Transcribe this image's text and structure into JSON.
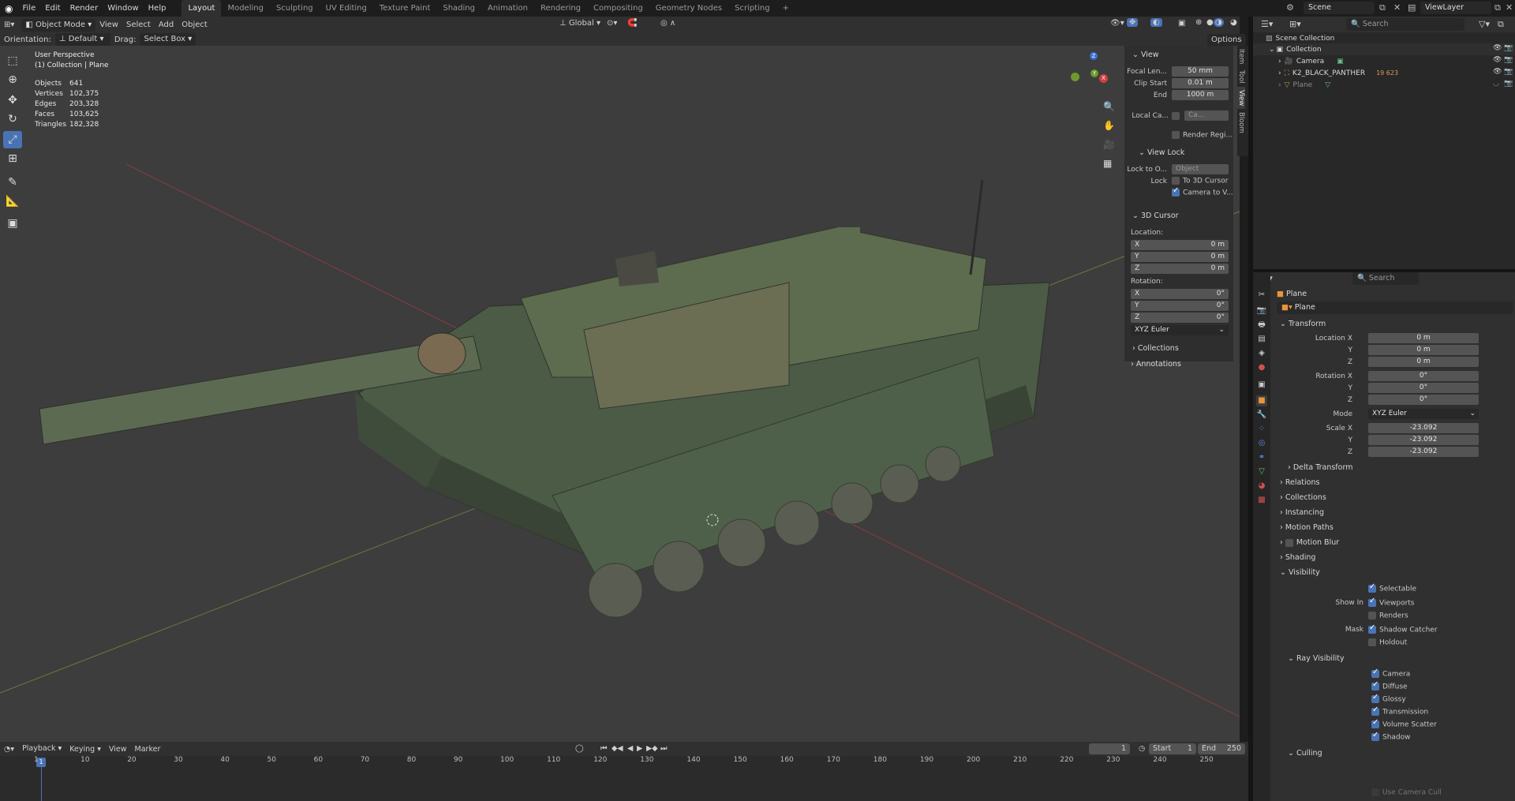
{
  "menu": {
    "logo": "blender-logo",
    "file": "File",
    "edit": "Edit",
    "render": "Render",
    "window": "Window",
    "help": "Help"
  },
  "workspaces": [
    "Layout",
    "Modeling",
    "Sculpting",
    "UV Editing",
    "Texture Paint",
    "Shading",
    "Animation",
    "Rendering",
    "Compositing",
    "Geometry Nodes",
    "Scripting",
    "+"
  ],
  "topright": {
    "scene": "Scene",
    "view_layer": "ViewLayer"
  },
  "viewport_header": {
    "mode": "Object Mode",
    "view": "View",
    "select": "Select",
    "add": "Add",
    "object": "Object",
    "transform": "Global",
    "orientation_label": "Orientation:",
    "orientation": "Default",
    "drag_label": "Drag:",
    "drag": "Select Box",
    "options": "Options"
  },
  "overlay": {
    "perspective": "User Perspective",
    "collection": "(1) Collection | Plane"
  },
  "stats": [
    {
      "k": "Objects",
      "v": "641"
    },
    {
      "k": "Vertices",
      "v": "102,375"
    },
    {
      "k": "Edges",
      "v": "203,328"
    },
    {
      "k": "Faces",
      "v": "103,625"
    },
    {
      "k": "Triangles",
      "v": "182,328"
    }
  ],
  "npanel": {
    "view_title": "View",
    "focal_label": "Focal Len...",
    "focal": "50 mm",
    "clip_start_label": "Clip Start",
    "clip_start": "0.01 m",
    "end_label": "End",
    "end": "1000 m",
    "local_cam_label": "Local Ca...",
    "local_cam": "Ca...",
    "render_region": "Render Regi...",
    "view_lock": "View Lock",
    "lock_obj_label": "Lock to O...",
    "lock_obj": "Object",
    "lock_label": "Lock",
    "to_cursor": "To 3D Cursor",
    "cam_to_view": "Camera to V...",
    "cursor_title": "3D Cursor",
    "location": "Location:",
    "loc": [
      {
        "a": "X",
        "v": "0 m"
      },
      {
        "a": "Y",
        "v": "0 m"
      },
      {
        "a": "Z",
        "v": "0 m"
      }
    ],
    "rotation": "Rotation:",
    "rot": [
      {
        "a": "X",
        "v": "0°"
      },
      {
        "a": "Y",
        "v": "0°"
      },
      {
        "a": "Z",
        "v": "0°"
      }
    ],
    "euler": "XYZ Euler",
    "collections": "Collections",
    "annotations": "Annotations",
    "tabs": [
      "Item",
      "Tool",
      "View",
      "Bloom"
    ]
  },
  "outliner": {
    "search": "Search",
    "scene_collection": "Scene Collection",
    "collection": "Collection",
    "items": [
      "Camera",
      "K2_BLACK_PANTHER",
      "Plane"
    ],
    "k2_badge": "19 623"
  },
  "props": {
    "search": "Search",
    "object_name": "Plane",
    "data_name": "Plane",
    "transform": "Transform",
    "location_label": "Location X",
    "loc": [
      "0 m",
      "0 m",
      "0 m"
    ],
    "rotation_label": "Rotation X",
    "rot": [
      "0°",
      "0°",
      "0°"
    ],
    "mode_label": "Mode",
    "mode": "XYZ Euler",
    "scale_label": "Scale X",
    "scale": [
      "-23.092",
      "-23.092",
      "-23.092"
    ],
    "axis_y": "Y",
    "axis_z": "Z",
    "sections": [
      "Delta Transform",
      "Relations",
      "Collections",
      "Instancing",
      "Motion Paths",
      "Motion Blur",
      "Shading",
      "Visibility"
    ],
    "selectable": "Selectable",
    "show_in": "Show In",
    "viewports": "Viewports",
    "renders": "Renders",
    "mask": "Mask",
    "shadow_catcher": "Shadow Catcher",
    "holdout": "Holdout",
    "ray_visibility": "Ray Visibility",
    "rays": [
      "Camera",
      "Diffuse",
      "Glossy",
      "Transmission",
      "Volume Scatter",
      "Shadow"
    ],
    "culling": "Culling",
    "use_camera_cull": "Use Camera Cull"
  },
  "timeline": {
    "playback": "Playback",
    "keying": "Keying",
    "view": "View",
    "marker": "Marker",
    "current": "1",
    "start_label": "Start",
    "start": "1",
    "end_label": "End",
    "end": "250",
    "ticks": [
      "1",
      "10",
      "20",
      "30",
      "40",
      "50",
      "60",
      "70",
      "80",
      "90",
      "100",
      "110",
      "120",
      "130",
      "140",
      "150",
      "160",
      "170",
      "180",
      "190",
      "200",
      "210",
      "220",
      "230",
      "240",
      "250"
    ]
  }
}
